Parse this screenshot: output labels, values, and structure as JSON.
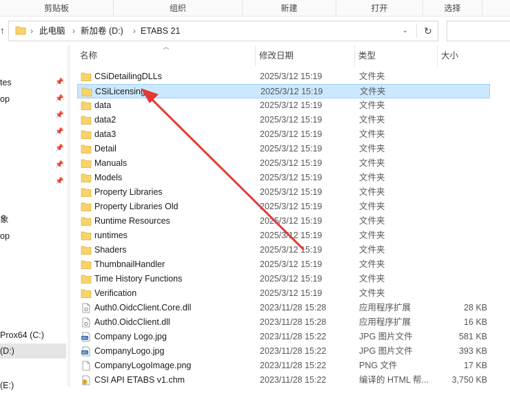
{
  "ribbon": {
    "groups": [
      "剪贴板",
      "组织",
      "新建",
      "打开",
      "选择"
    ]
  },
  "address": {
    "up_glyph": "↑",
    "breadcrumb": [
      "此电脑",
      "新加卷 (D:)",
      "ETABS 21"
    ],
    "separator": "›",
    "dropdown_glyph": "⌄",
    "refresh_glyph": "↻"
  },
  "nav": {
    "items": [
      "",
      "tes",
      "op",
      "",
      "",
      "",
      "",
      "",
      "象",
      "op",
      "",
      "",
      "",
      "",
      "Prox64 (C:)",
      "(D:)",
      "(E:)"
    ]
  },
  "columns": {
    "name": "名称",
    "date": "修改日期",
    "type": "类型",
    "size": "大小"
  },
  "files": [
    {
      "name": "CSiDetailingDLLs",
      "date": "2025/3/12 15:19",
      "type": "文件夹",
      "size": "",
      "icon": "folder-icon"
    },
    {
      "name": "CSiLicensing",
      "date": "2025/3/12 15:19",
      "type": "文件夹",
      "size": "",
      "icon": "folder-icon"
    },
    {
      "name": "data",
      "date": "2025/3/12 15:19",
      "type": "文件夹",
      "size": "",
      "icon": "folder-icon"
    },
    {
      "name": "data2",
      "date": "2025/3/12 15:19",
      "type": "文件夹",
      "size": "",
      "icon": "folder-icon"
    },
    {
      "name": "data3",
      "date": "2025/3/12 15:19",
      "type": "文件夹",
      "size": "",
      "icon": "folder-icon"
    },
    {
      "name": "Detail",
      "date": "2025/3/12 15:19",
      "type": "文件夹",
      "size": "",
      "icon": "folder-icon"
    },
    {
      "name": "Manuals",
      "date": "2025/3/12 15:19",
      "type": "文件夹",
      "size": "",
      "icon": "folder-icon"
    },
    {
      "name": "Models",
      "date": "2025/3/12 15:19",
      "type": "文件夹",
      "size": "",
      "icon": "folder-icon"
    },
    {
      "name": "Property Libraries",
      "date": "2025/3/12 15:19",
      "type": "文件夹",
      "size": "",
      "icon": "folder-icon"
    },
    {
      "name": "Property Libraries Old",
      "date": "2025/3/12 15:19",
      "type": "文件夹",
      "size": "",
      "icon": "folder-icon"
    },
    {
      "name": "Runtime Resources",
      "date": "2025/3/12 15:19",
      "type": "文件夹",
      "size": "",
      "icon": "folder-icon"
    },
    {
      "name": "runtimes",
      "date": "2025/3/12 15:19",
      "type": "文件夹",
      "size": "",
      "icon": "folder-icon"
    },
    {
      "name": "Shaders",
      "date": "2025/3/12 15:19",
      "type": "文件夹",
      "size": "",
      "icon": "folder-icon"
    },
    {
      "name": "ThumbnailHandler",
      "date": "2025/3/12 15:19",
      "type": "文件夹",
      "size": "",
      "icon": "folder-icon"
    },
    {
      "name": "Time History Functions",
      "date": "2025/3/12 15:19",
      "type": "文件夹",
      "size": "",
      "icon": "folder-icon"
    },
    {
      "name": "Verification",
      "date": "2025/3/12 15:19",
      "type": "文件夹",
      "size": "",
      "icon": "folder-icon"
    },
    {
      "name": "Auth0.OidcClient.Core.dll",
      "date": "2023/11/28 15:28",
      "type": "应用程序扩展",
      "size": "28 KB",
      "icon": "dll-file-icon"
    },
    {
      "name": "Auth0.OidcClient.dll",
      "date": "2023/11/28 15:28",
      "type": "应用程序扩展",
      "size": "16 KB",
      "icon": "dll-file-icon"
    },
    {
      "name": "Company Logo.jpg",
      "date": "2023/11/28 15:22",
      "type": "JPG 图片文件",
      "size": "581 KB",
      "icon": "jpg-file-icon"
    },
    {
      "name": "CompanyLogo.jpg",
      "date": "2023/11/28 15:22",
      "type": "JPG 图片文件",
      "size": "393 KB",
      "icon": "jpg-file-icon"
    },
    {
      "name": "CompanyLogoImage.png",
      "date": "2023/11/28 15:22",
      "type": "PNG 文件",
      "size": "17 KB",
      "icon": "png-file-icon"
    },
    {
      "name": "CSI API ETABS v1.chm",
      "date": "2023/11/28 15:22",
      "type": "编译的 HTML 帮...",
      "size": "3,750 KB",
      "icon": "chm-file-icon"
    }
  ],
  "selected_index": 1,
  "colors": {
    "selection_bg": "#cce8ff",
    "selection_border": "#99d1ff",
    "folder": "#f8d36a",
    "annotation_arrow": "#e53935"
  }
}
